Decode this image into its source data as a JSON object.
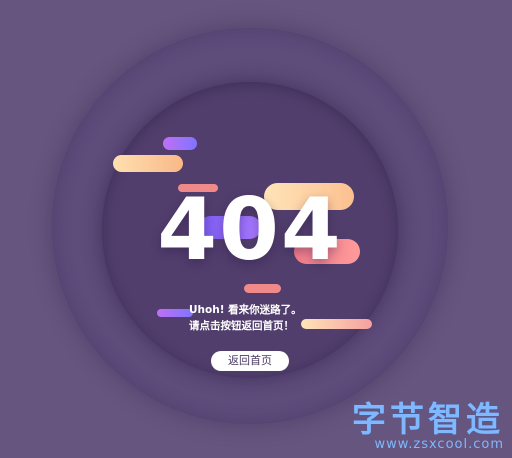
{
  "error": {
    "code": "404",
    "message_line1": "Uhoh! 看来你迷路了。",
    "message_line2": "请点击按钮返回首页！"
  },
  "actions": {
    "home_label": "返回首页"
  },
  "watermark": {
    "title": "字节智造",
    "url": "www.zsxcool.com"
  },
  "colors": {
    "background": "#66557e",
    "ring_outer": "#5e4c7b",
    "ring_inner": "#513e6c",
    "accent_pink": "#f07c8a",
    "accent_peach": "#ffd3a0",
    "accent_purple": "#8f6dff",
    "watermark": "#7fb8ff"
  }
}
